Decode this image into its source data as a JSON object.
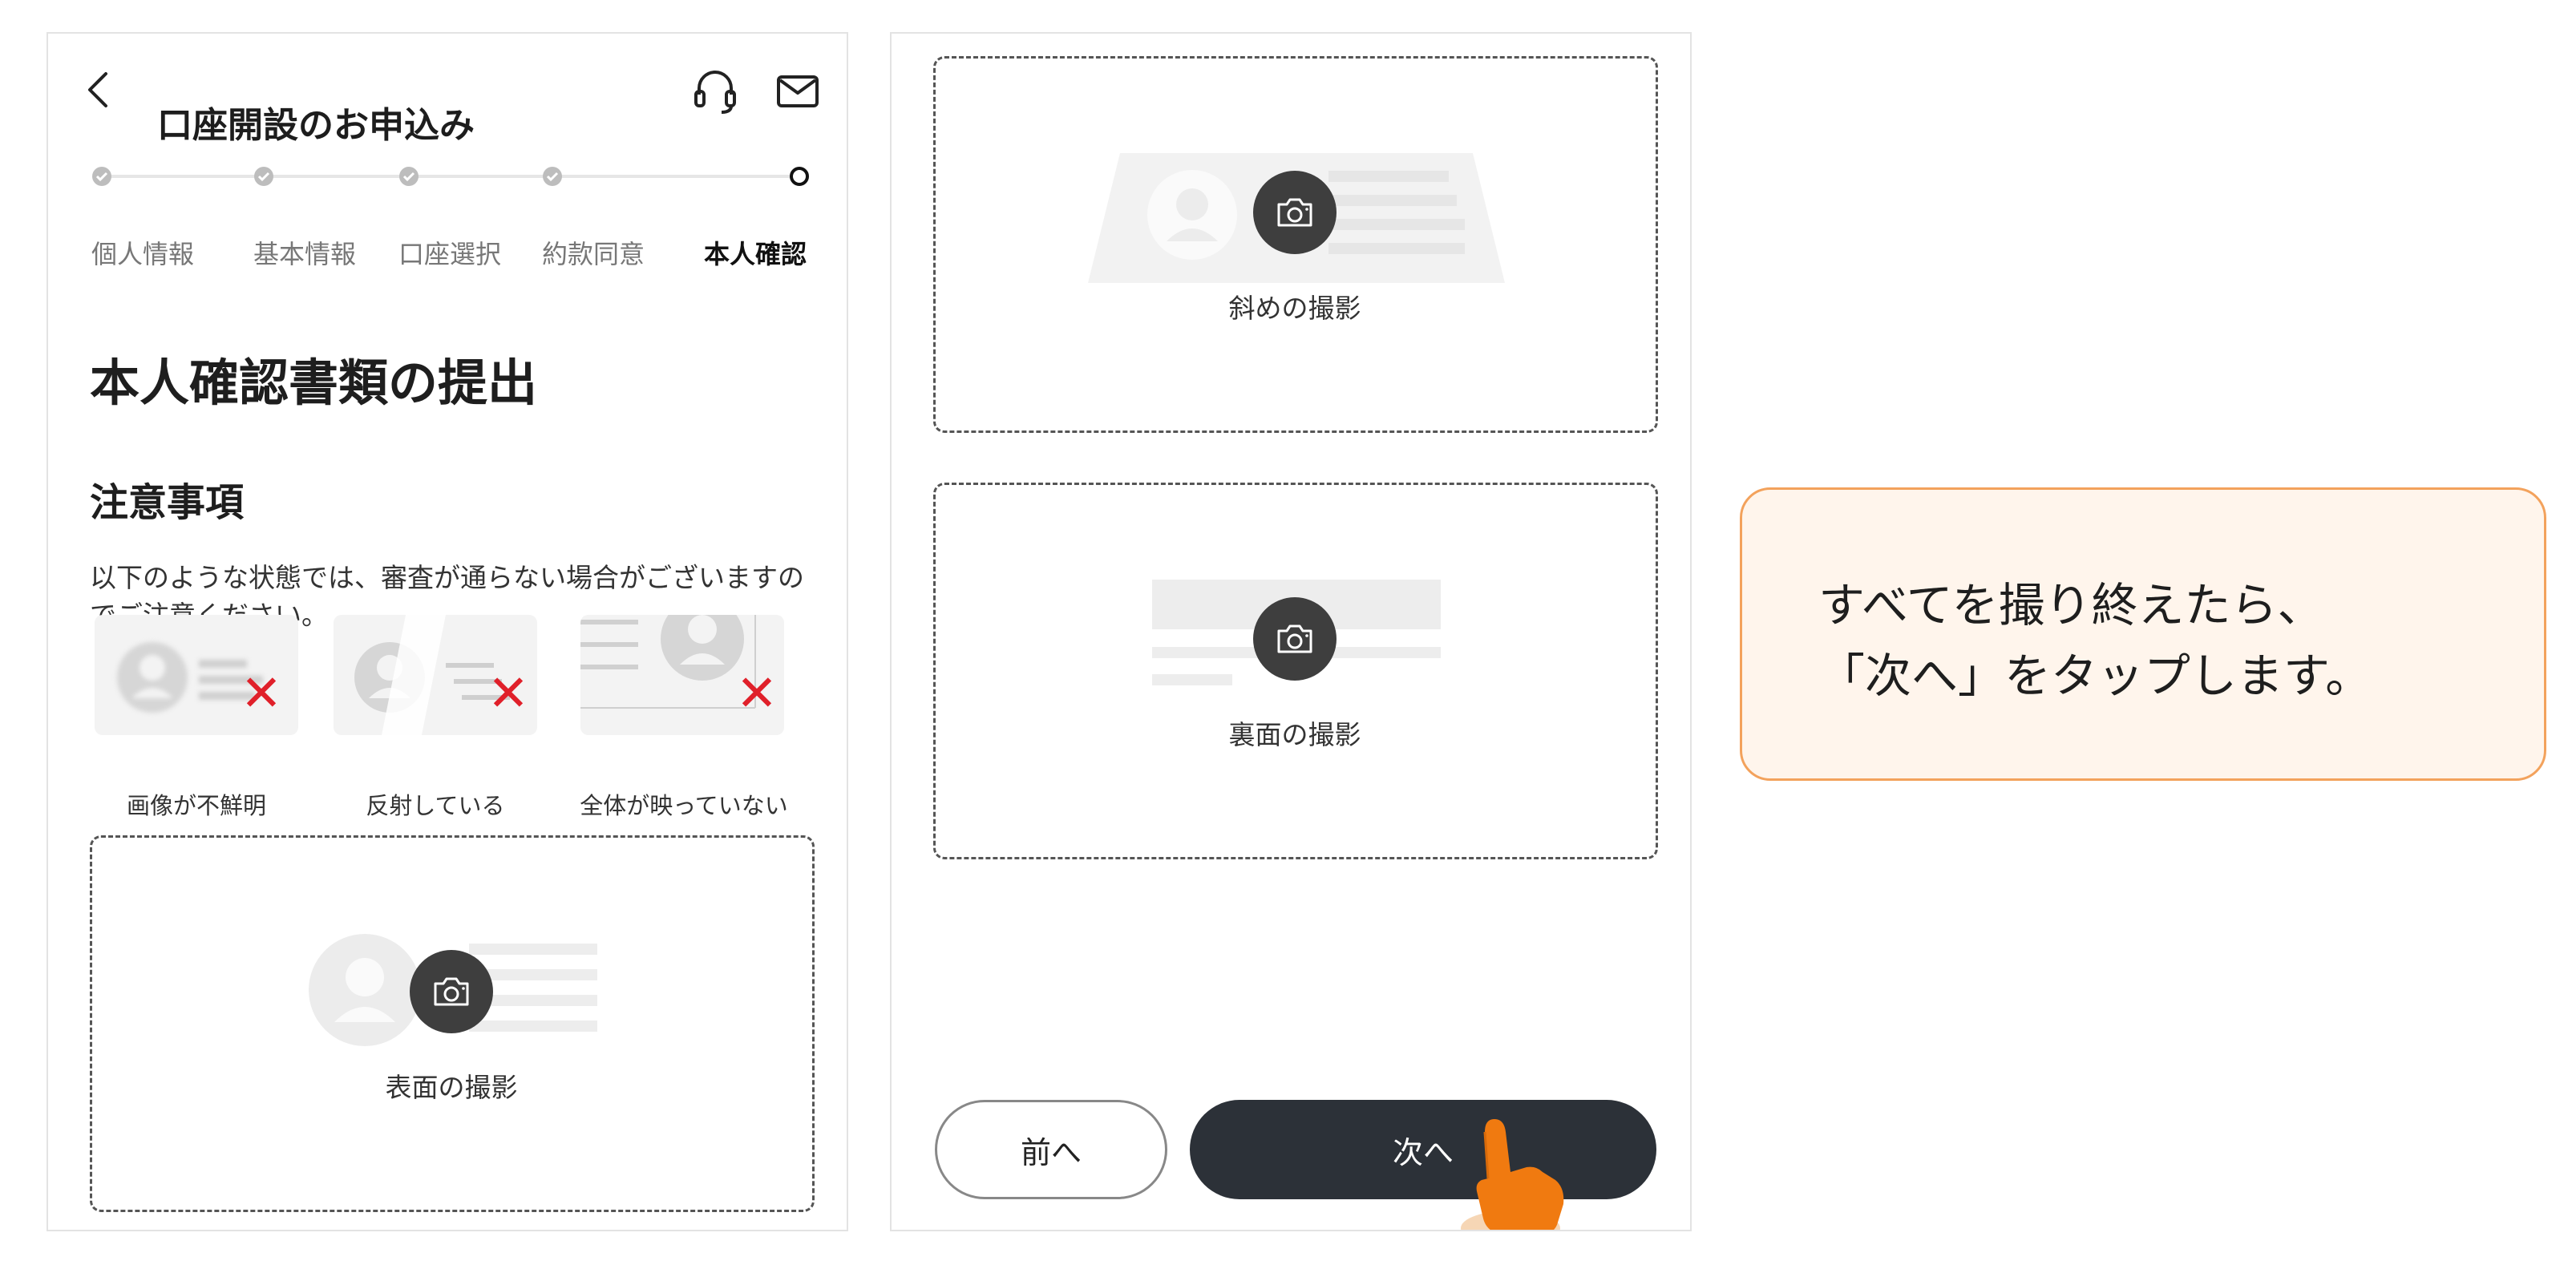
{
  "header": {
    "title": "口座開設のお申込み"
  },
  "stepper": {
    "steps": [
      {
        "label": "個人情報",
        "state": "done"
      },
      {
        "label": "基本情報",
        "state": "done"
      },
      {
        "label": "口座選択",
        "state": "done"
      },
      {
        "label": "約款同意",
        "state": "done"
      },
      {
        "label": "本人確認",
        "state": "current"
      }
    ]
  },
  "main": {
    "section_title": "本人確認書類の提出",
    "notes_title": "注意事項",
    "notes_text": "以下のような状態では、審査が通らない場合がございますのでご注意ください。",
    "bad_examples": [
      {
        "caption": "画像が不鮮明"
      },
      {
        "caption": "反射している"
      },
      {
        "caption": "全体が映っていない"
      }
    ],
    "captures": [
      {
        "label": "表面の撮影"
      },
      {
        "label": "斜めの撮影"
      },
      {
        "label": "裏面の撮影"
      }
    ]
  },
  "footer": {
    "prev_label": "前へ",
    "next_label": "次へ"
  },
  "callout": {
    "text": "すべてを撮り終えたら、\n「次へ」をタップします。"
  },
  "colors": {
    "next_button": "#2c3138",
    "error_mark": "#e0202a",
    "callout_bg": "#fff5ec",
    "callout_border": "#f3a25c",
    "pointer_hand": "#f07a10"
  }
}
